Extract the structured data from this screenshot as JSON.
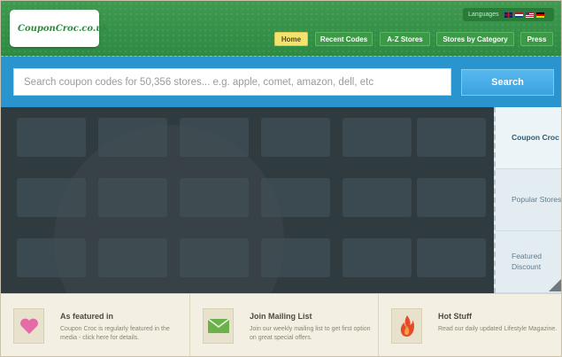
{
  "header": {
    "logo_text": "CouponCroc.co.uk",
    "languages_label": "Languages",
    "languages": [
      "uk-flag-icon",
      "nl-flag-icon",
      "us-flag-icon",
      "de-flag-icon"
    ],
    "nav": [
      {
        "label": "Home",
        "active": true
      },
      {
        "label": "Recent Codes",
        "active": false
      },
      {
        "label": "A-Z Stores",
        "active": false
      },
      {
        "label": "Stores by Category",
        "active": false
      },
      {
        "label": "Press",
        "active": false
      }
    ]
  },
  "search": {
    "placeholder": "Search coupon codes for 50,356 stores... e.g. apple, comet, amazon, dell, etc",
    "button_label": "Search"
  },
  "side_tabs": [
    {
      "label": "Coupon Croc",
      "active": true
    },
    {
      "label": "Popular Stores",
      "active": false
    },
    {
      "label": "Featured Discount",
      "active": false
    }
  ],
  "features": [
    {
      "icon": "heart-icon",
      "title": "As featured in",
      "description": "Coupon Croc is regularly featured in the media - click here for details."
    },
    {
      "icon": "envelope-icon",
      "title": "Join Mailing List",
      "description": "Join our weekly mailing list to get first option on great special offers."
    },
    {
      "icon": "flame-icon",
      "title": "Hot Stuff",
      "description": "Read our daily updated Lifestyle Magazine."
    }
  ],
  "colors": {
    "header_green": "#2e8a42",
    "search_blue": "#2a94cf",
    "search_button": "#3aa2e0",
    "active_nav": "#f2e36e",
    "heart": "#e56aa8",
    "envelope": "#6bb04a",
    "flame": "#e54a2a"
  }
}
